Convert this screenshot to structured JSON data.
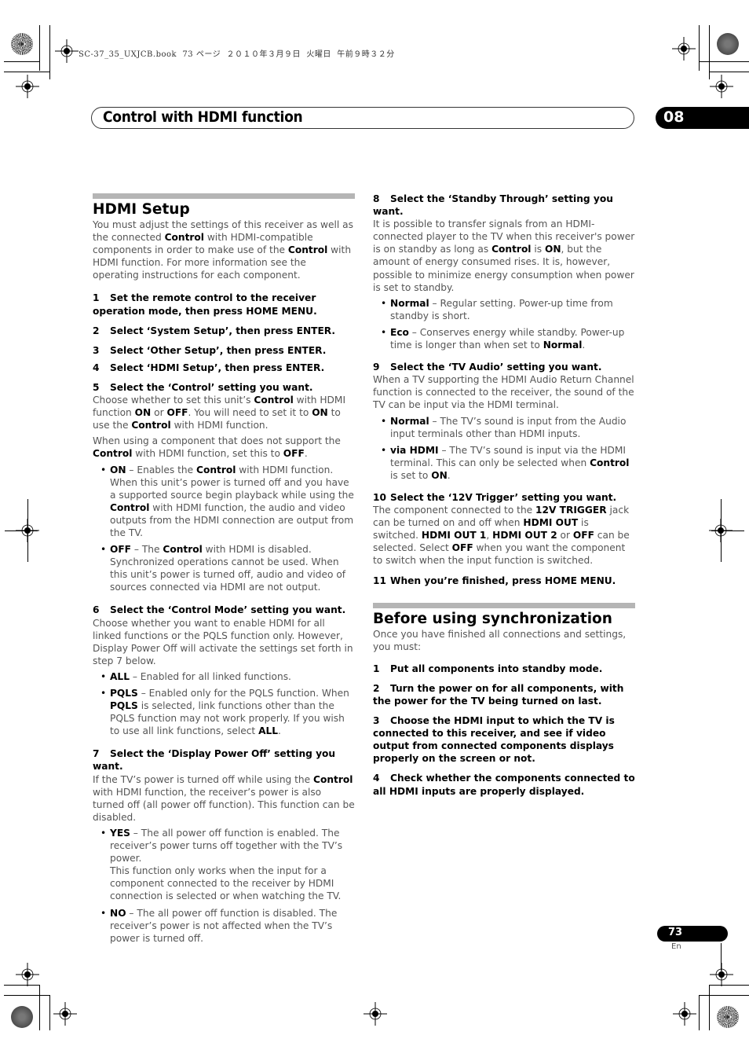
{
  "print_header": "SC-37_35_UXJCB.book  73 ページ  ２０１０年３月９日  火曜日  午前９時３２分",
  "chapter": {
    "title": "Control with HDMI function",
    "number": "08"
  },
  "page": {
    "number": "73",
    "language": "En"
  },
  "hdmi_setup": {
    "title": "HDMI Setup",
    "intro": [
      "You must adjust the settings of this receiver as well as the connected ",
      "Control",
      " with HDMI-compatible components in order to make use of the ",
      "Control",
      " with HDMI function. For more information see the operating instructions for each component."
    ],
    "steps": [
      {
        "num": "1",
        "text": "Set the remote control to the receiver operation mode, then press HOME MENU."
      },
      {
        "num": "2",
        "text": "Select ‘System Setup’, then press ENTER."
      },
      {
        "num": "3",
        "text": "Select ‘Other Setup’, then press ENTER."
      },
      {
        "num": "4",
        "text": "Select ‘HDMI Setup’, then press ENTER."
      },
      {
        "num": "5",
        "text": "Select the ‘Control’ setting you want."
      },
      {
        "num": "6",
        "text": "Select the ‘Control Mode’ setting you want."
      },
      {
        "num": "7",
        "text": "Select the ‘Display Power Off’ setting you want."
      },
      {
        "num": "8",
        "text": "Select the ‘Standby Through’ setting you want."
      },
      {
        "num": "9",
        "text": "Select the ‘TV Audio’ setting you want."
      },
      {
        "num": "10",
        "text": "Select the ‘12V Trigger’ setting you want."
      },
      {
        "num": "11",
        "text": "When you’re finished, press HOME MENU."
      }
    ],
    "step5": {
      "p1": [
        "Choose whether to set this unit’s ",
        "Control",
        " with HDMI function ",
        "ON",
        " or ",
        "OFF",
        ". You will need to set it to ",
        "ON",
        " to use the ",
        "Control",
        " with HDMI function."
      ],
      "p2": [
        "When using a component that does not support the ",
        "Control",
        " with HDMI function, set this to ",
        "OFF",
        "."
      ],
      "options": [
        {
          "name": "ON",
          "t1": " – Enables the ",
          "b1": "Control",
          "t2": " with HDMI function. When this unit’s power is turned off and you have a supported source begin playback while using the ",
          "b2": "Control",
          "t3": " with HDMI function, the audio and video outputs from the HDMI connection are output from the TV."
        },
        {
          "name": "OFF",
          "t1": " – The ",
          "b1": "Control",
          "t2": " with HDMI is disabled. Synchronized operations cannot be used. When this unit’s power is turned off, audio and video of sources connected via HDMI are not output."
        }
      ]
    },
    "step6": {
      "p1": "Choose whether you want to enable HDMI for all linked functions or the PQLS function only. However, Display Power Off will activate the settings set forth in step 7 below.",
      "options": [
        {
          "name": "ALL",
          "text": " – Enabled for all linked functions."
        },
        {
          "name": "PQLS",
          "t1": " – Enabled only for the PQLS function. When ",
          "b1": "PQLS",
          "t2": " is selected, link functions other than the PQLS function may not work properly. If you wish to use all link functions, select ",
          "b2": "ALL",
          "t3": "."
        }
      ]
    },
    "step7": {
      "p1": [
        "If the TV’s power is turned off while using the ",
        "Control",
        " with HDMI function, the receiver’s power is also turned off (all power off function). This function can be disabled."
      ],
      "options": [
        {
          "name": "YES",
          "text": " – The all power off function is enabled. The receiver’s power turns off together with the TV’s power.",
          "note": "This function only works when the input for a component connected to the receiver by HDMI connection is selected or when watching the TV."
        },
        {
          "name": "NO",
          "text": " – The all power off function is disabled. The receiver’s power is not affected when the TV’s power is turned off."
        }
      ]
    },
    "step8": {
      "p1": [
        "It is possible to transfer signals from an HDMI-connected player to the TV when this receiver's power is on standby as long as ",
        "Control",
        " is ",
        "ON",
        ", but the amount of energy consumed rises. It is, however, possible to minimize energy consumption when power is set to standby."
      ],
      "options": [
        {
          "name": "Normal",
          "text": " – Regular setting. Power-up time from standby is short."
        },
        {
          "name": "Eco",
          "t1": " – Conserves energy while standby. Power-up time is longer than when set to ",
          "b1": "Normal",
          "t2": "."
        }
      ]
    },
    "step9": {
      "p1": "When a TV supporting the HDMI Audio Return Channel function is connected to the receiver, the sound of the TV can be input via the HDMI terminal.",
      "options": [
        {
          "name": "Normal",
          "text": " – The TV’s sound is input from the Audio input terminals other than HDMI inputs."
        },
        {
          "name": "via HDMI",
          "t1": " – The TV’s sound is input via the HDMI terminal. This can only be selected when ",
          "b1": "Control",
          "t2": " is set to ",
          "b2": "ON",
          "t3": "."
        }
      ]
    },
    "step10": {
      "p1": [
        "The component connected to the ",
        "12V TRIGGER",
        " jack can be turned on and off when ",
        "HDMI OUT",
        " is switched. ",
        "HDMI OUT 1",
        ", ",
        "HDMI OUT 2",
        " or ",
        "OFF",
        " can be selected. Select ",
        "OFF",
        " when you want the component to switch when the input function is switched."
      ]
    }
  },
  "sync": {
    "title": "Before using synchronization",
    "intro": "Once you have finished all connections and settings, you must:",
    "steps": [
      {
        "num": "1",
        "text": "Put all components into standby mode."
      },
      {
        "num": "2",
        "text": "Turn the power on for all components, with the power for the TV being turned on last."
      },
      {
        "num": "3",
        "text": "Choose the HDMI input to which the TV is connected to this receiver, and see if video output from connected components displays properly on the screen or not."
      },
      {
        "num": "4",
        "text": "Check whether the components connected to all HDMI inputs are properly displayed."
      }
    ]
  }
}
